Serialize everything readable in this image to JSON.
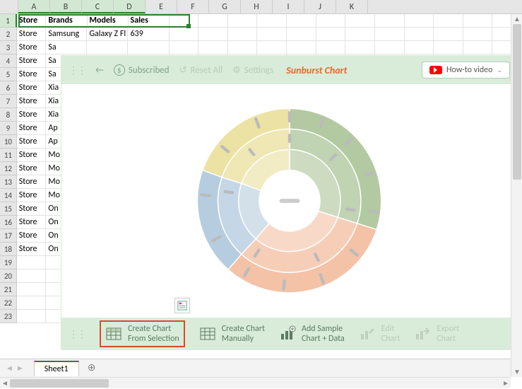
{
  "columns": [
    "A",
    "B",
    "C",
    "D",
    "E",
    "F",
    "G",
    "H",
    "I",
    "J",
    "K"
  ],
  "headers": {
    "c0": "Store",
    "c1": "Brands",
    "c2": "Models",
    "c3": "Sales"
  },
  "rows": [
    {
      "c0": "Store",
      "c1": "Samsung",
      "c2": "Galaxy Z Fl",
      "c3": "639"
    },
    {
      "c0": "Store",
      "c1": "Sa"
    },
    {
      "c0": "Store",
      "c1": "Sa"
    },
    {
      "c0": "Store",
      "c1": "Sa"
    },
    {
      "c0": "Store",
      "c1": "Xia"
    },
    {
      "c0": "Store",
      "c1": "Xia"
    },
    {
      "c0": "Store",
      "c1": "Xia"
    },
    {
      "c0": "Store",
      "c1": "Ap"
    },
    {
      "c0": "Store",
      "c1": "Ap"
    },
    {
      "c0": "Store",
      "c1": "Mo"
    },
    {
      "c0": "Store",
      "c1": "Mo"
    },
    {
      "c0": "Store",
      "c1": "Mo"
    },
    {
      "c0": "Store",
      "c1": "Mo"
    },
    {
      "c0": "Store",
      "c1": "On"
    },
    {
      "c0": "Store",
      "c1": "On"
    },
    {
      "c0": "Store",
      "c1": "On"
    },
    {
      "c0": "Store",
      "c1": "On"
    }
  ],
  "toolbar": {
    "back": "←",
    "subscribed": "Subscribed",
    "reset": "Reset All",
    "settings": "Settings",
    "title": "Sunburst Chart",
    "howto": "How-to video"
  },
  "bottom": {
    "b1a": "Create Chart",
    "b1b": "From Selection",
    "b2a": "Create Chart",
    "b2b": "Manually",
    "b3a": "Add Sample",
    "b3b": "Chart + Data",
    "b4a": "Edit",
    "b4b": "Chart",
    "b5a": "Export",
    "b5b": "Chart"
  },
  "sheet": {
    "name": "Sheet1"
  },
  "chart_data": {
    "type": "sunburst",
    "note": "placeholder preview – no numeric data labels rendered",
    "ring_colors": [
      "#e8dd9c",
      "#9fbb8f",
      "#f2b89a",
      "#a7c3db"
    ],
    "levels": 3
  }
}
